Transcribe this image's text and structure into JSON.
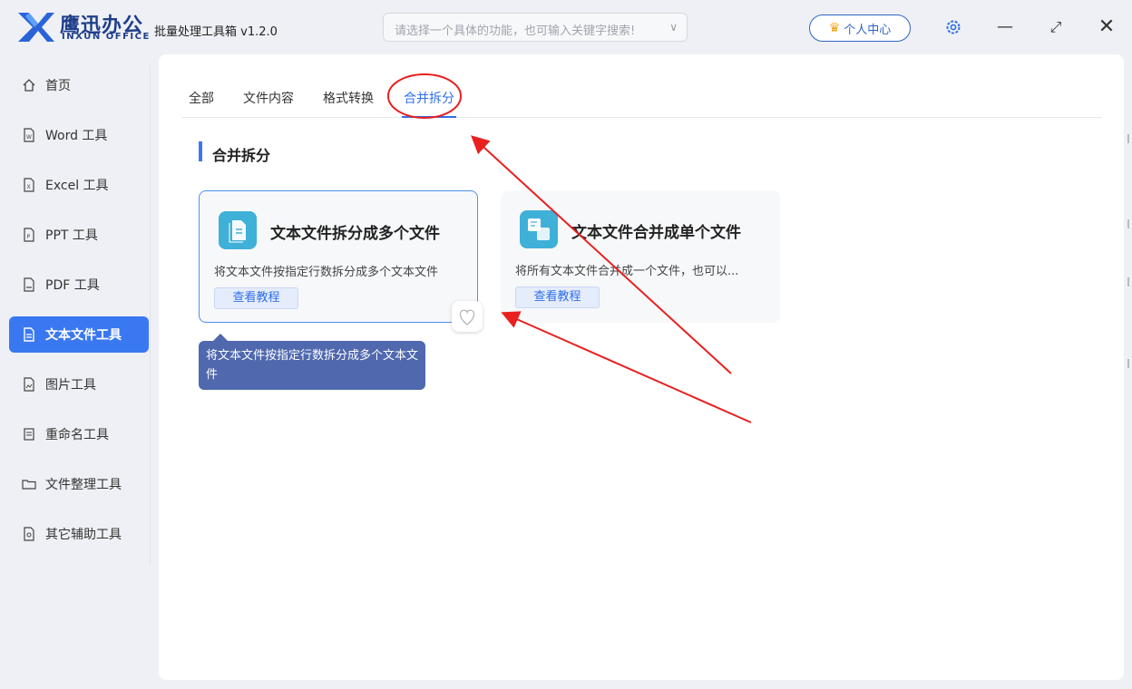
{
  "app": {
    "logo_cn": "鹰迅办公",
    "logo_en": "INXUN OFFICE",
    "title": "批量处理工具箱 v1.2.0",
    "search_placeholder": "请选择一个具体的功能，也可输入关键字搜索!",
    "user_center": "个人中心"
  },
  "sidebar": {
    "items": [
      {
        "label": "首页",
        "icon": "home-icon"
      },
      {
        "label": "Word 工具",
        "icon": "word-file-icon"
      },
      {
        "label": "Excel 工具",
        "icon": "excel-file-icon"
      },
      {
        "label": "PPT 工具",
        "icon": "ppt-file-icon"
      },
      {
        "label": "PDF 工具",
        "icon": "pdf-file-icon"
      },
      {
        "label": "文本文件工具",
        "icon": "text-file-icon",
        "active": true
      },
      {
        "label": "图片工具",
        "icon": "image-file-icon"
      },
      {
        "label": "重命名工具",
        "icon": "rename-icon"
      },
      {
        "label": "文件整理工具",
        "icon": "folder-icon"
      },
      {
        "label": "其它辅助工具",
        "icon": "tools-icon"
      }
    ]
  },
  "tabs": [
    "全部",
    "文件内容",
    "格式转换",
    "合并拆分"
  ],
  "active_tab": "合并拆分",
  "section_title": "合并拆分",
  "cards": [
    {
      "title": "文本文件拆分成多个文件",
      "desc": "将文本文件按指定行数拆分成多个文本文件",
      "button": "查看教程"
    },
    {
      "title": "文本文件合并成单个文件",
      "desc": "将所有文本文件合并成一个文件，也可以...",
      "button": "查看教程"
    }
  ],
  "tooltip": "将文本文件按指定行数拆分成多个文本文件",
  "colors": {
    "accent": "#3a78f2",
    "annotation": "#e8201f",
    "tooltip": "#4f68ae"
  }
}
